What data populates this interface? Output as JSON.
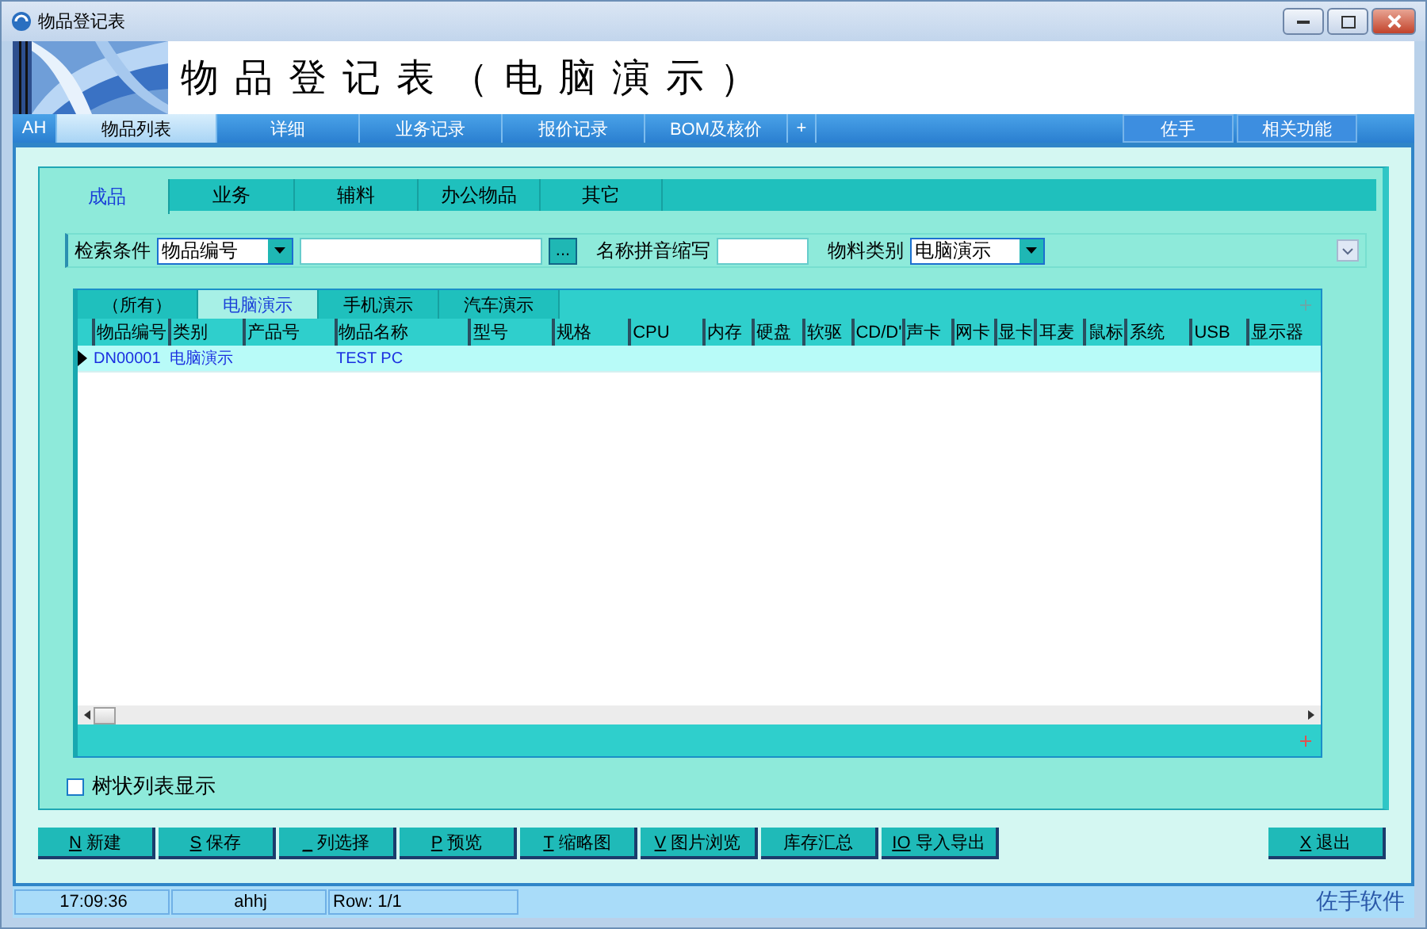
{
  "window": {
    "title": "物品登记表"
  },
  "banner": {
    "title": "物品登记表（电脑演示）"
  },
  "nav_tabs": [
    {
      "label": "AH",
      "selected": false
    },
    {
      "label": "物品列表",
      "selected": true
    },
    {
      "label": "详细",
      "selected": false
    },
    {
      "label": "业务记录",
      "selected": false
    },
    {
      "label": "报价记录",
      "selected": false
    },
    {
      "label": "BOM及核价",
      "selected": false
    },
    {
      "label": "+",
      "selected": false
    }
  ],
  "nav_actions": [
    "佐手",
    "相关功能"
  ],
  "category_tabs": [
    {
      "label": "成品",
      "selected": true
    },
    {
      "label": "业务",
      "selected": false
    },
    {
      "label": "辅料",
      "selected": false
    },
    {
      "label": "办公物品",
      "selected": false
    },
    {
      "label": "其它",
      "selected": false
    }
  ],
  "search": {
    "criteria_label": "检索条件",
    "criteria_value": "物品编号",
    "browse_button": "...",
    "pinyin_label": "名称拼音缩写",
    "material_label": "物料类别",
    "material_value": "电脑演示"
  },
  "sub_tabs": [
    {
      "label": "（所有）",
      "selected": false
    },
    {
      "label": "电脑演示",
      "selected": true
    },
    {
      "label": "手机演示",
      "selected": false
    },
    {
      "label": "汽车演示",
      "selected": false
    }
  ],
  "table": {
    "columns": [
      "物品编号",
      "类别",
      "产品号",
      "物品名称",
      "型号",
      "规格",
      "CPU",
      "内存",
      "硬盘",
      "软驱",
      "CD/D'",
      "声卡",
      "网卡",
      "显卡",
      "耳麦",
      "鼠标",
      "系统",
      "USB",
      "显示器"
    ],
    "rows": [
      {
        "selected": true,
        "cells": [
          {
            "text": "DN00001"
          },
          {
            "text": "电脑演示"
          },
          {},
          {
            "text": "TEST PC"
          }
        ]
      }
    ]
  },
  "tree_view": {
    "label": "树状列表显示",
    "checked": false
  },
  "buttons": [
    {
      "hotkey": "N",
      "label": "新建"
    },
    {
      "hotkey": "S",
      "label": "保存"
    },
    {
      "hotkey": "_",
      "label": "列选择"
    },
    {
      "hotkey": "P",
      "label": "预览"
    },
    {
      "hotkey": "T",
      "label": "缩略图"
    },
    {
      "hotkey": "V",
      "label": "图片浏览"
    },
    {
      "label": "库存汇总"
    },
    {
      "hotkey": "IO",
      "label": "导入导出"
    }
  ],
  "exit_button": {
    "hotkey": "X",
    "label": "退出"
  },
  "status_bar": {
    "time": "17:09:36",
    "user": "ahhj",
    "row": "Row: 1/1",
    "brand": "佐手软件"
  }
}
